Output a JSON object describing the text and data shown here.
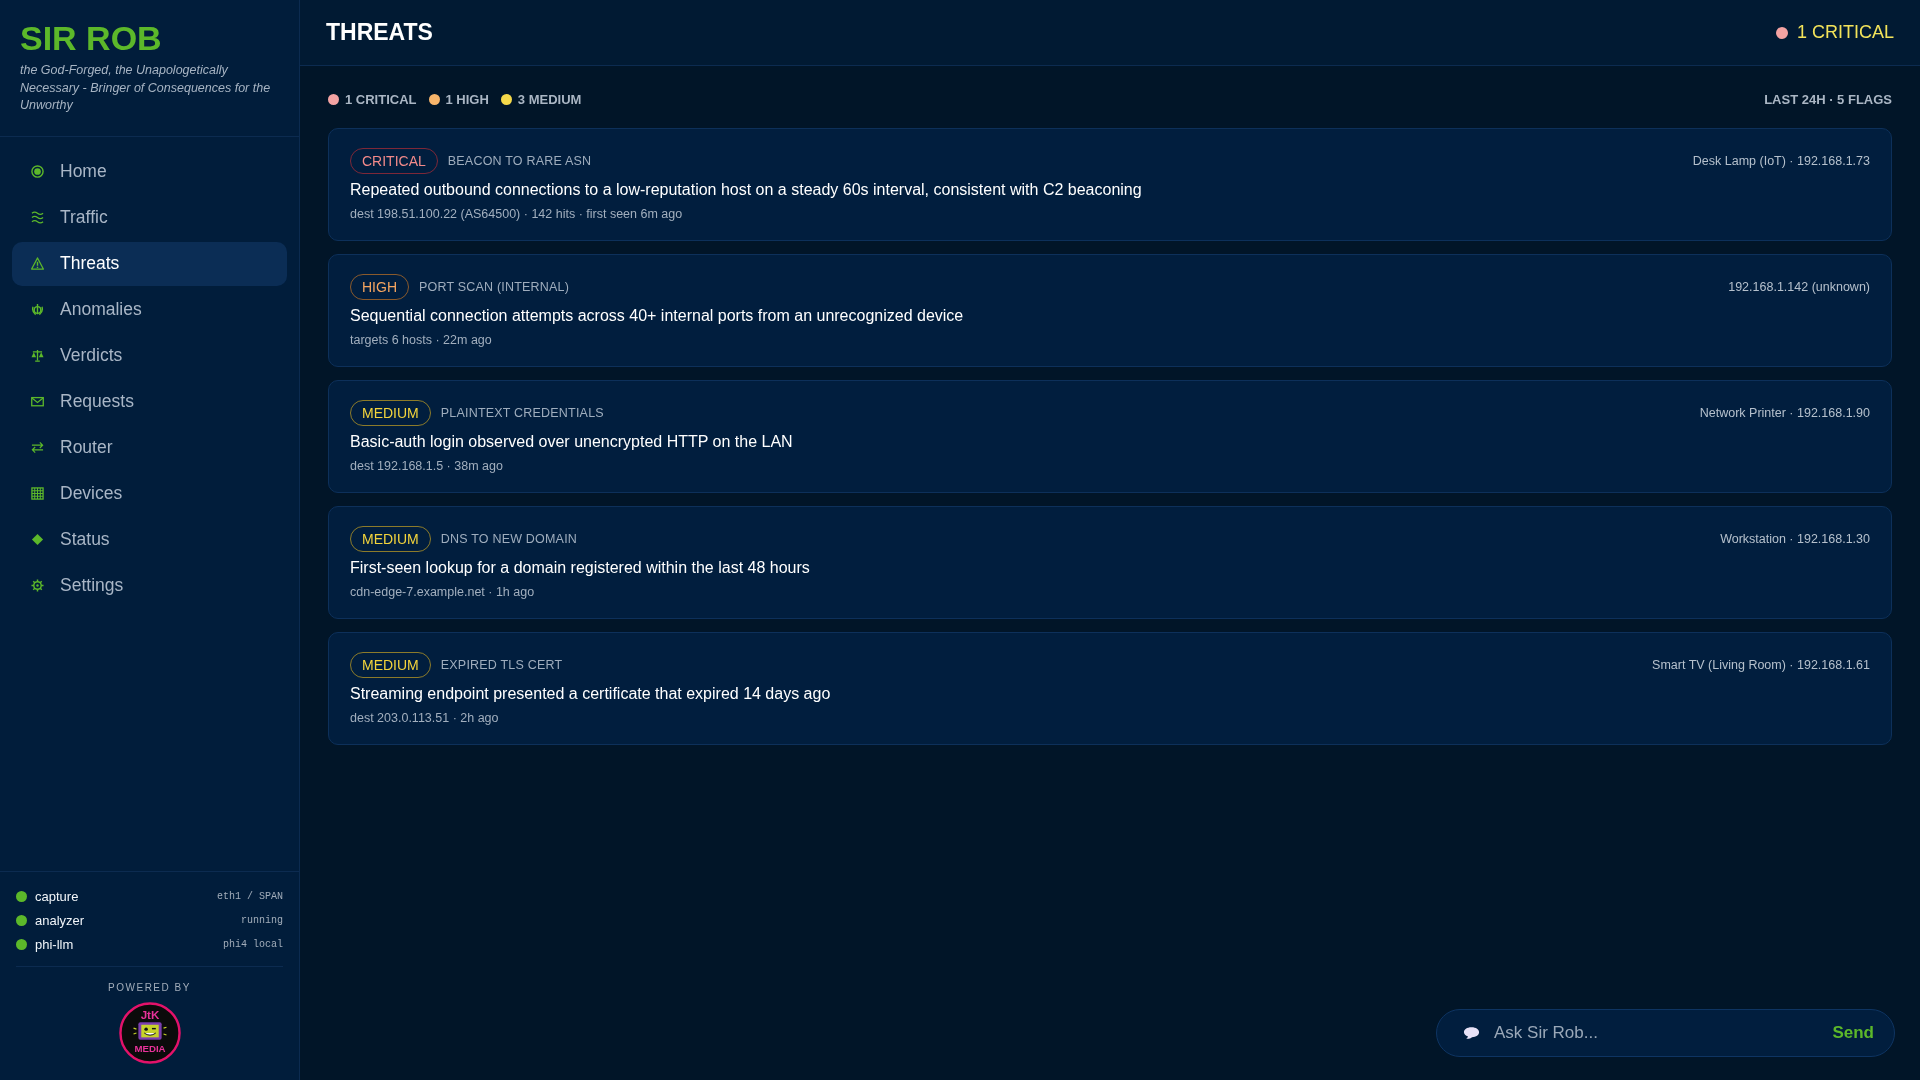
{
  "brand": {
    "title": "SIR ROB",
    "tagline": "the God-Forged, the Unapologetically Necessary - Bringer of Consequences for the Unworthy"
  },
  "nav": [
    {
      "label": "Home",
      "selected": false
    },
    {
      "label": "Traffic",
      "selected": false
    },
    {
      "label": "Threats",
      "selected": true
    },
    {
      "label": "Anomalies",
      "selected": false
    },
    {
      "label": "Verdicts",
      "selected": false
    },
    {
      "label": "Requests",
      "selected": false
    },
    {
      "label": "Router",
      "selected": false
    },
    {
      "label": "Devices",
      "selected": false
    },
    {
      "label": "Status",
      "selected": false
    },
    {
      "label": "Settings",
      "selected": false
    }
  ],
  "services": [
    {
      "name": "capture",
      "detail": "eth1 / SPAN",
      "online": true
    },
    {
      "name": "analyzer",
      "detail": "running",
      "online": true
    },
    {
      "name": "phi-llm",
      "detail": "phi4 local",
      "online": true
    }
  ],
  "powered_by": {
    "label": "POWERED BY",
    "logo_top": "JtK",
    "logo_bottom": "MEDIA"
  },
  "header": {
    "title": "THREATS",
    "alert": {
      "text": "1 CRITICAL",
      "color": "#f4a3a3"
    }
  },
  "summary": {
    "counts": [
      {
        "text": "1 CRITICAL",
        "color": "#f4a3a3"
      },
      {
        "text": "1 HIGH",
        "color": "#f7b56b"
      },
      {
        "text": "3 MEDIUM",
        "color": "#f5d94a"
      }
    ],
    "range": "LAST 24H · 5 FLAGS"
  },
  "threats": [
    {
      "kind": "critical",
      "badge": "CRITICAL",
      "category": "BEACON TO RARE ASN",
      "device": "Desk Lamp (IoT) · 192.168.1.73",
      "title": "Repeated outbound connections to a low-reputation host on a steady 60s interval, consistent with C2 beaconing",
      "meta": "dest 198.51.100.22 (AS64500) · 142 hits · first seen 6m ago"
    },
    {
      "kind": "high",
      "badge": "HIGH",
      "category": "PORT SCAN (INTERNAL)",
      "device": "192.168.1.142 (unknown)",
      "title": "Sequential connection attempts across 40+ internal ports from an unrecognized device",
      "meta": "targets 6 hosts · 22m ago"
    },
    {
      "kind": "medium",
      "badge": "MEDIUM",
      "category": "PLAINTEXT CREDENTIALS",
      "device": "Network Printer · 192.168.1.90",
      "title": "Basic-auth login observed over unencrypted HTTP on the LAN",
      "meta": "dest 192.168.1.5 · 38m ago"
    },
    {
      "kind": "medium",
      "badge": "MEDIUM",
      "category": "DNS TO NEW DOMAIN",
      "device": "Workstation · 192.168.1.30",
      "title": "First-seen lookup for a domain registered within the last 48 hours",
      "meta": "cdn-edge-7.example.net · 1h ago"
    },
    {
      "kind": "medium",
      "badge": "MEDIUM",
      "category": "EXPIRED TLS CERT",
      "device": "Smart TV (Living Room) · 192.168.1.61",
      "title": "Streaming endpoint presented a certificate that expired 14 days ago",
      "meta": "dest 203.0.113.51 · 2h ago"
    }
  ],
  "chat": {
    "placeholder": "Ask Sir Rob...",
    "send": "Send"
  }
}
